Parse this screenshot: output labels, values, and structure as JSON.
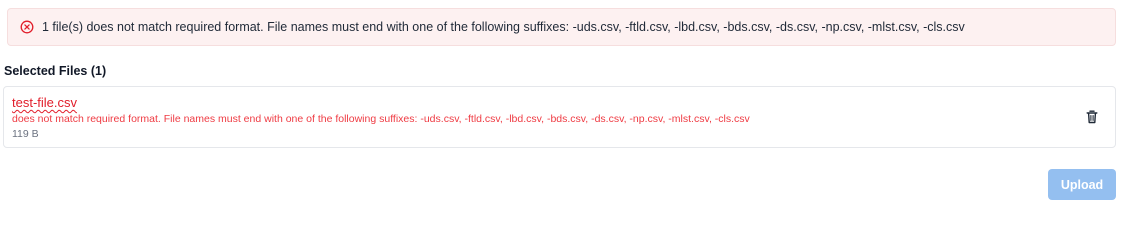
{
  "alert": {
    "icon": "error-circle-x-icon",
    "message": "1 file(s) does not match required format. File names must end with one of the following suffixes: -uds.csv, -ftld.csv, -lbd.csv, -bds.csv, -ds.csv, -np.csv, -mlst.csv, -cls.csv",
    "color": "#e11d2a"
  },
  "selected_files": {
    "title": "Selected Files (1)",
    "files": [
      {
        "name": "test-file.csv",
        "error": "does not match required format. File names must end with one of the following suffixes: -uds.csv, -ftld.csv, -lbd.csv, -bds.csv, -ds.csv, -np.csv, -mlst.csv, -cls.csv",
        "size": "119 B",
        "delete_icon": "trash-icon"
      }
    ]
  },
  "upload": {
    "label": "Upload",
    "color": "#94bff0"
  }
}
